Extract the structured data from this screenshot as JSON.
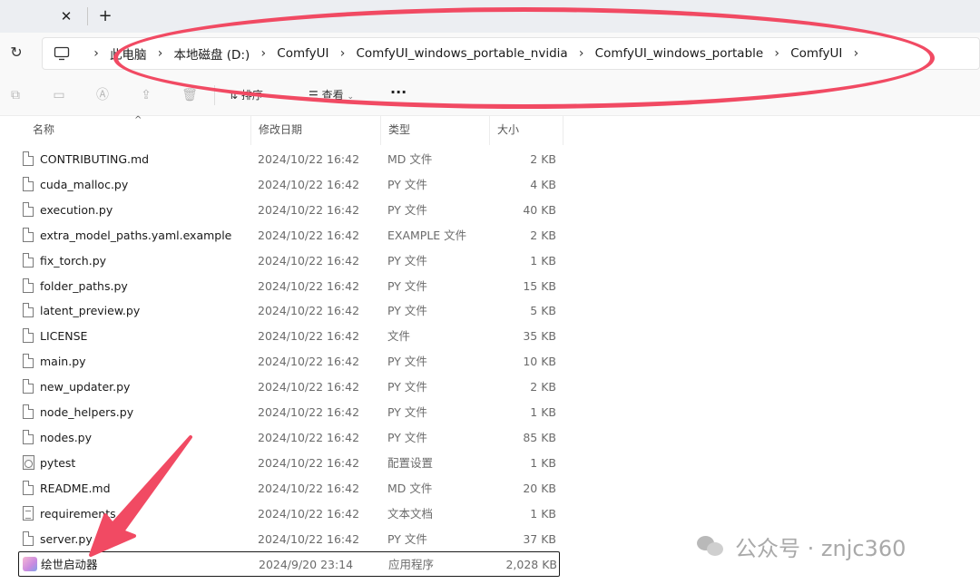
{
  "tabs": {
    "close_glyph": "✕",
    "new_tab_glyph": "+"
  },
  "addressbar": {
    "breadcrumbs": [
      "此电脑",
      "本地磁盘 (D:)",
      "ComfyUI",
      "ComfyUI_windows_portable_nvidia",
      "ComfyUI_windows_portable",
      "ComfyUI"
    ]
  },
  "toolbar": {
    "sort_label": "排序",
    "view_label": "查看",
    "more_glyph": "···"
  },
  "columns": {
    "name": "名称",
    "date": "修改日期",
    "type": "类型",
    "size": "大小"
  },
  "files": [
    {
      "name": "CONTRIBUTING.md",
      "date": "2024/10/22 16:42",
      "type": "MD 文件",
      "size": "2 KB",
      "icon": "file-icon"
    },
    {
      "name": "cuda_malloc.py",
      "date": "2024/10/22 16:42",
      "type": "PY 文件",
      "size": "4 KB",
      "icon": "file-icon"
    },
    {
      "name": "execution.py",
      "date": "2024/10/22 16:42",
      "type": "PY 文件",
      "size": "40 KB",
      "icon": "file-icon"
    },
    {
      "name": "extra_model_paths.yaml.example",
      "date": "2024/10/22 16:42",
      "type": "EXAMPLE 文件",
      "size": "2 KB",
      "icon": "file-icon"
    },
    {
      "name": "fix_torch.py",
      "date": "2024/10/22 16:42",
      "type": "PY 文件",
      "size": "1 KB",
      "icon": "file-icon"
    },
    {
      "name": "folder_paths.py",
      "date": "2024/10/22 16:42",
      "type": "PY 文件",
      "size": "15 KB",
      "icon": "file-icon"
    },
    {
      "name": "latent_preview.py",
      "date": "2024/10/22 16:42",
      "type": "PY 文件",
      "size": "5 KB",
      "icon": "file-icon"
    },
    {
      "name": "LICENSE",
      "date": "2024/10/22 16:42",
      "type": "文件",
      "size": "35 KB",
      "icon": "file-icon"
    },
    {
      "name": "main.py",
      "date": "2024/10/22 16:42",
      "type": "PY 文件",
      "size": "10 KB",
      "icon": "file-icon"
    },
    {
      "name": "new_updater.py",
      "date": "2024/10/22 16:42",
      "type": "PY 文件",
      "size": "2 KB",
      "icon": "file-icon"
    },
    {
      "name": "node_helpers.py",
      "date": "2024/10/22 16:42",
      "type": "PY 文件",
      "size": "1 KB",
      "icon": "file-icon"
    },
    {
      "name": "nodes.py",
      "date": "2024/10/22 16:42",
      "type": "PY 文件",
      "size": "85 KB",
      "icon": "file-icon"
    },
    {
      "name": "pytest",
      "date": "2024/10/22 16:42",
      "type": "配置设置",
      "size": "1 KB",
      "icon": "config-file-icon"
    },
    {
      "name": "README.md",
      "date": "2024/10/22 16:42",
      "type": "MD 文件",
      "size": "20 KB",
      "icon": "file-icon"
    },
    {
      "name": "requirements",
      "date": "2024/10/22 16:42",
      "type": "文本文档",
      "size": "1 KB",
      "icon": "text-file-icon"
    },
    {
      "name": "server.py",
      "date": "2024/10/22 16:42",
      "type": "PY 文件",
      "size": "37 KB",
      "icon": "file-icon"
    },
    {
      "name": "绘世启动器",
      "date": "2024/9/20 23:14",
      "type": "应用程序",
      "size": "2,028 KB",
      "icon": "app-icon",
      "selected": true
    }
  ],
  "watermark": {
    "text": "公众号 · znjc360"
  },
  "colors": {
    "annotation": "#f14a63",
    "selection_border": "#1a1a1a"
  }
}
